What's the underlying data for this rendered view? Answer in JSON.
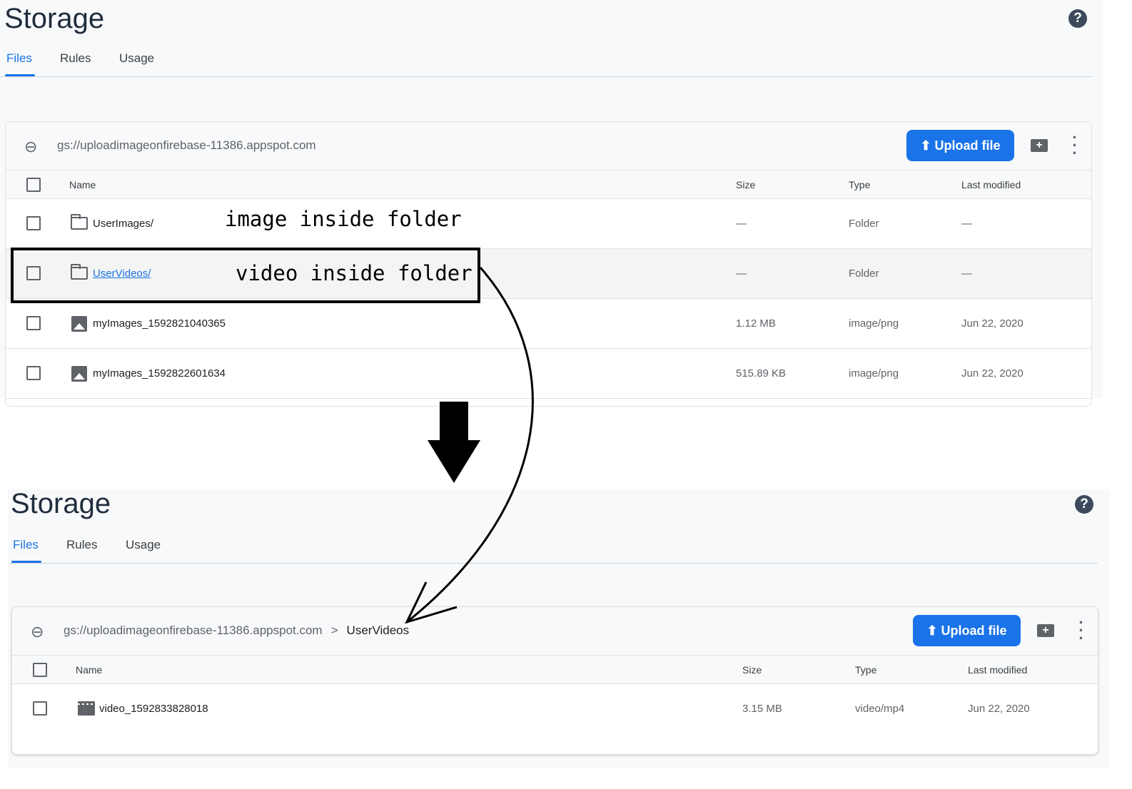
{
  "top": {
    "title": "Storage",
    "help": "?",
    "tabs": [
      "Files",
      "Rules",
      "Usage"
    ],
    "bucket": "gs://uploadimageonfirebase-11386.appspot.com",
    "upload_label": "Upload file",
    "columns": [
      "Name",
      "Size",
      "Type",
      "Last modified"
    ],
    "rows": [
      {
        "name": "UserImages/",
        "size": "—",
        "type": "Folder",
        "modified": "—"
      },
      {
        "name": "UserVideos/",
        "size": "—",
        "type": "Folder",
        "modified": "—"
      },
      {
        "name": "myImages_1592821040365",
        "size": "1.12 MB",
        "type": "image/png",
        "modified": "Jun 22, 2020"
      },
      {
        "name": "myImages_1592822601634",
        "size": "515.89 KB",
        "type": "image/png",
        "modified": "Jun 22, 2020"
      }
    ]
  },
  "annotations": {
    "image": "image inside folder",
    "video": "video inside folder"
  },
  "bottom": {
    "title": "Storage",
    "help": "?",
    "tabs": [
      "Files",
      "Rules",
      "Usage"
    ],
    "bucket": "gs://uploadimageonfirebase-11386.appspot.com",
    "breadcrumb_sep": ">",
    "folder": "UserVideos",
    "upload_label": "Upload file",
    "columns": [
      "Name",
      "Size",
      "Type",
      "Last modified"
    ],
    "rows": [
      {
        "name": "video_1592833828018",
        "size": "3.15 MB",
        "type": "video/mp4",
        "modified": "Jun 22, 2020"
      }
    ]
  }
}
